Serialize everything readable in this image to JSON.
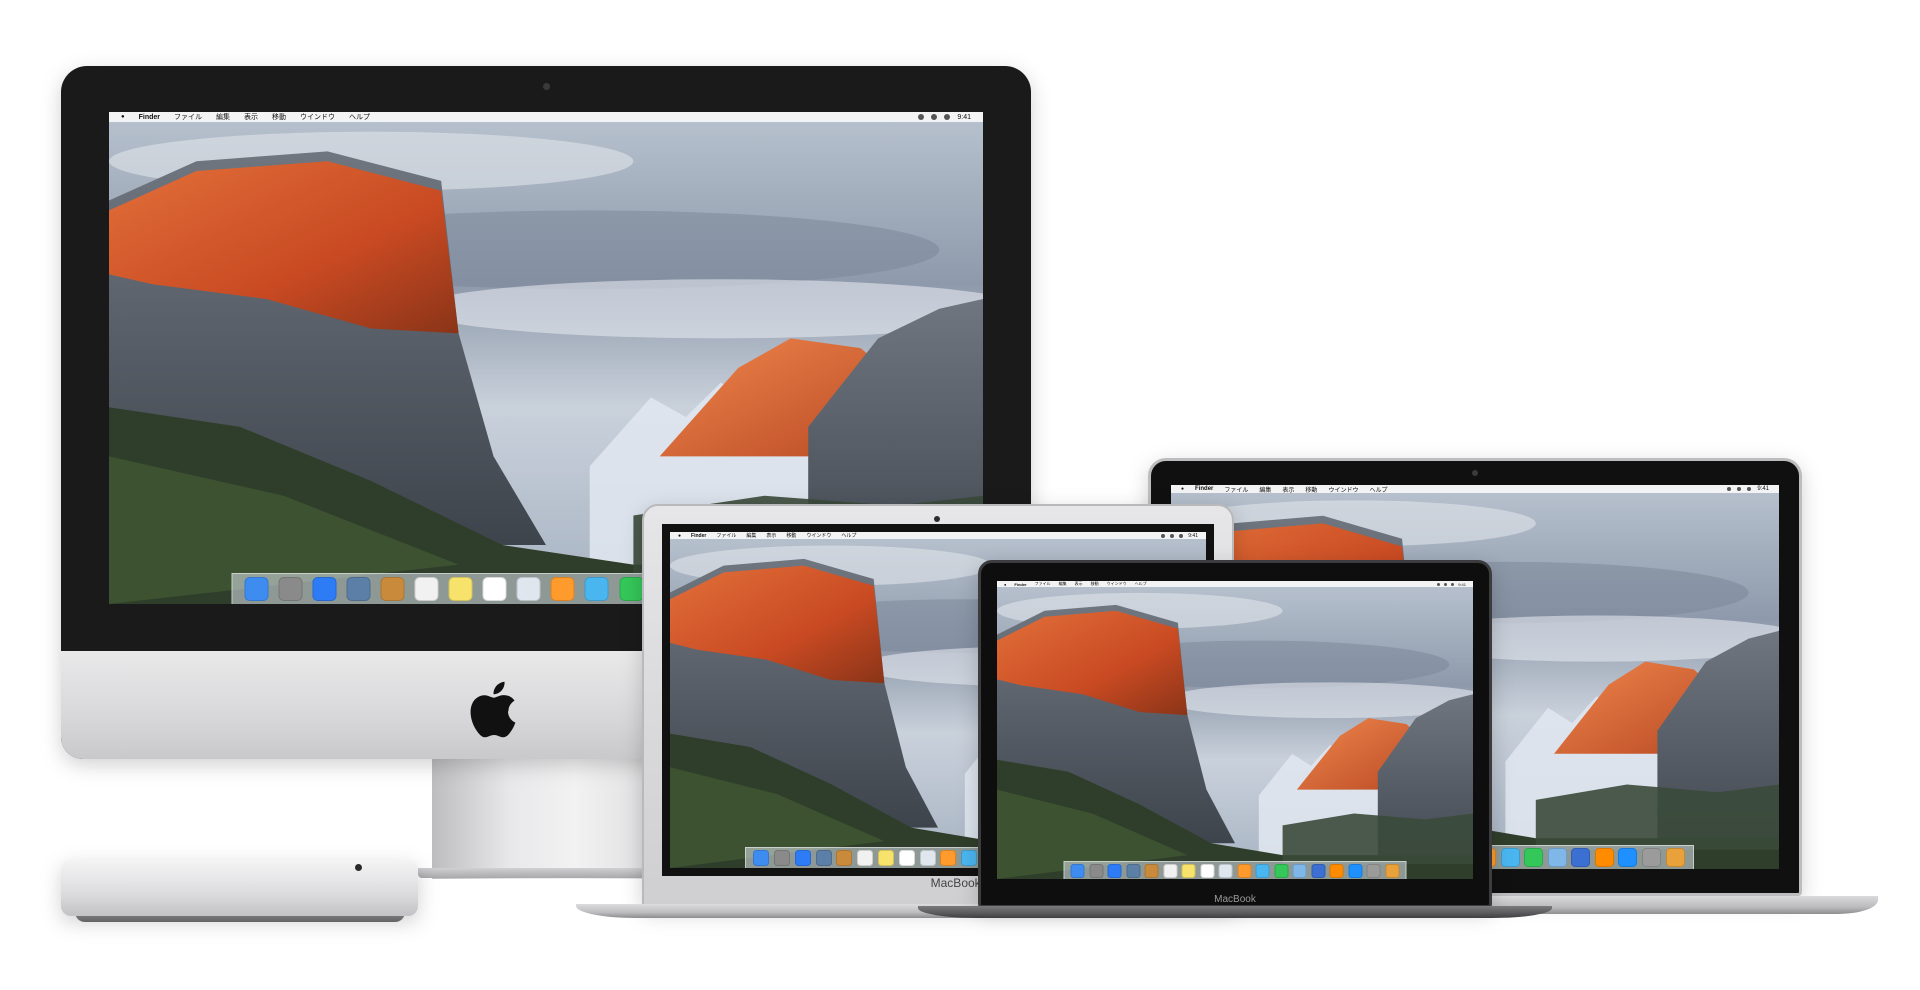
{
  "menubar": {
    "app": "Finder",
    "items": [
      "ファイル",
      "編集",
      "表示",
      "移動",
      "ウインドウ",
      "ヘルプ"
    ],
    "clock": "9:41"
  },
  "devices": {
    "macbook_air_label": "MacBook Air",
    "macbook_label": "MacBook"
  },
  "colors": {
    "background": "#ffffff",
    "imac_bezel": "#1a1a1a",
    "aluminum": "#d8d8da",
    "rock_orange": "#d2562a",
    "sky": "#aab6c4"
  },
  "dock_icon_colors": [
    "#3f8cf0",
    "#8a8a8a",
    "#2d7cf6",
    "#5b7fa6",
    "#c98b3b",
    "#f1f1f1",
    "#f7e36c",
    "#ffffff",
    "#e0e6ee",
    "#ff9a2c",
    "#4ab6f0",
    "#34c759",
    "#7fb8e8",
    "#3b6fd1",
    "#ff8c00",
    "#1e90ff",
    "#9b9b9b",
    "#e9a13b"
  ]
}
